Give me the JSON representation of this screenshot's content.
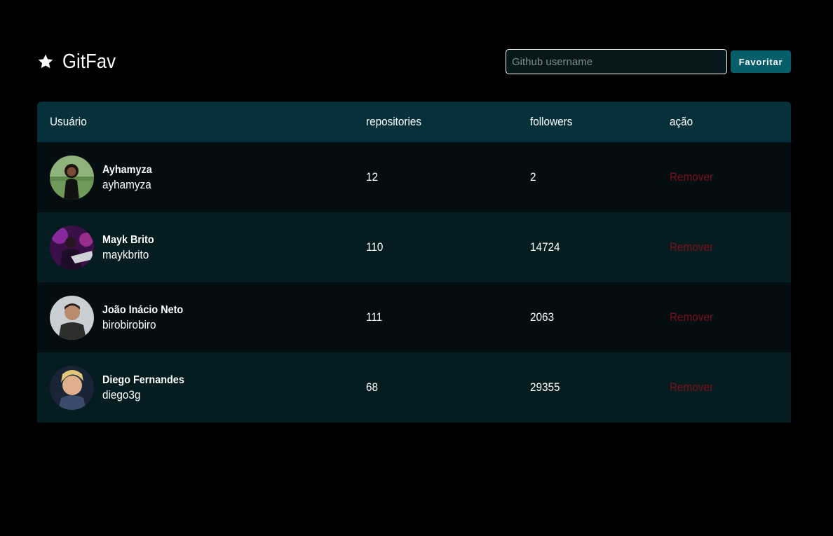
{
  "header": {
    "title": "GitFav",
    "icon": "star-icon"
  },
  "search": {
    "value": "",
    "placeholder": "Github username",
    "button_label": "Favoritar"
  },
  "table": {
    "columns": [
      "Usuário",
      "repositories",
      "followers",
      "ação"
    ],
    "rows": [
      {
        "name": "Ayhamyza",
        "login": "ayhamyza",
        "repositories": "12",
        "followers": "2",
        "action": "Remover"
      },
      {
        "name": "Mayk Brito",
        "login": "maykbrito",
        "repositories": "110",
        "followers": "14724",
        "action": "Remover"
      },
      {
        "name": "João Inácio Neto",
        "login": "birobirobiro",
        "repositories": "111",
        "followers": "2063",
        "action": "Remover"
      },
      {
        "name": "Diego Fernandes",
        "login": "diego3g",
        "repositories": "68",
        "followers": "29355",
        "action": "Remover"
      }
    ]
  },
  "colors": {
    "background": "#000000",
    "header_row": "#07313a",
    "row_odd": "#040e10",
    "row_even": "#051c21",
    "button": "#065e6b",
    "remove": "#7c1117"
  }
}
